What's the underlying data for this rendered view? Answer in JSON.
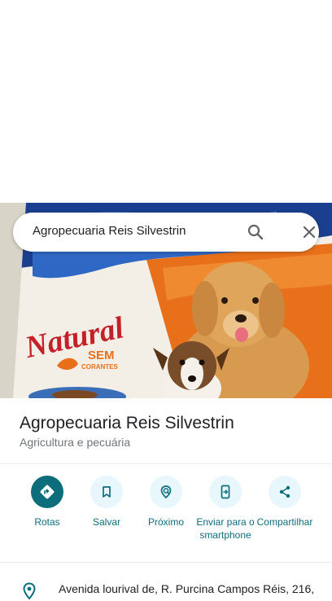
{
  "search": {
    "query": "Agropecuaria Reis Silvestrin",
    "search_icon": "search-icon",
    "close_icon": "close-icon"
  },
  "photo": {
    "packaging_text_1": "Natural",
    "packaging_text_2": "SEM",
    "packaging_text_3": "CORANTES"
  },
  "place": {
    "name": "Agropecuaria Reis Silvestrin",
    "category": "Agricultura e pecuária"
  },
  "actions": [
    {
      "label": "Rotas",
      "icon": "directions-icon"
    },
    {
      "label": "Salvar",
      "icon": "bookmark-icon"
    },
    {
      "label": "Próximo",
      "icon": "nearby-icon"
    },
    {
      "label": "Enviar para o smartphone",
      "icon": "send-to-phone-icon"
    },
    {
      "label": "Compartilhar",
      "icon": "share-icon"
    }
  ],
  "address": {
    "icon": "location-pin-icon",
    "text": "Avenida lourival de, R. Purcina Campos Réis, 216,"
  },
  "colors": {
    "accent": "#0e6d7b",
    "action_bg": "#e8f7fb",
    "divider": "#e8eaed",
    "secondary_text": "#70757a"
  }
}
